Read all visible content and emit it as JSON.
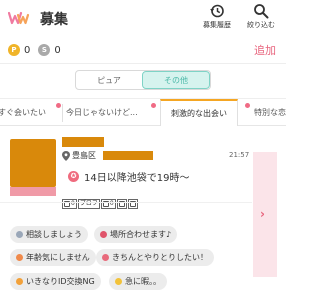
{
  "header": {
    "title": "募集",
    "history_label": "募集履歴",
    "filter_label": "絞り込む",
    "logo_icon": "ww-logo",
    "brand_color": "#e8647d"
  },
  "points": {
    "p_value": "0",
    "s_value": "0",
    "p_badge": "P",
    "s_badge": "S",
    "add_label": "追加"
  },
  "segment": {
    "options": [
      "ピュア",
      "その他"
    ],
    "selected": "その他"
  },
  "tabs": [
    {
      "label": "すぐ会いたい"
    },
    {
      "label": "今日じゃないけど..."
    },
    {
      "label": "刺激的な出会い"
    },
    {
      "label": "特別な恋"
    }
  ],
  "post": {
    "area": "豊島区",
    "time": "21:57",
    "message": "14日以降池袋で19時〜",
    "badges": [
      "0",
      "プロフ",
      "0"
    ],
    "tags": [
      "相談しましょう",
      "場所合わせます♪",
      "年齢気にしません",
      "きちんとやりとりしたい！",
      "いきなりID交換NG",
      "急に暇。。"
    ]
  }
}
